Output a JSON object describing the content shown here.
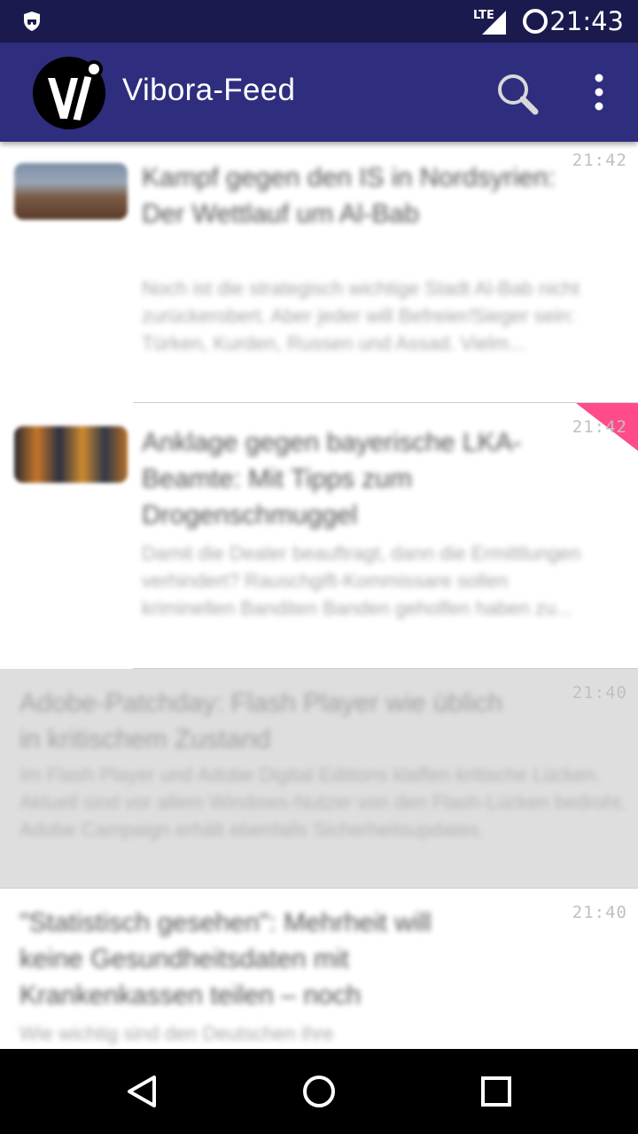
{
  "status_bar": {
    "network": "LTE",
    "time": "21:43",
    "icons": [
      "incognito-shield-icon",
      "signal-icon",
      "battery-saver-icon"
    ]
  },
  "app_bar": {
    "title": "Vibora-Feed",
    "logo": "vibora-logo",
    "actions": [
      "search-icon",
      "overflow-menu-icon"
    ],
    "color": "#2e2d7e"
  },
  "feed": {
    "items": [
      {
        "time": "21:42",
        "title": "Kampf gegen den IS in Nordsyrien: Der Wettlauf um Al-Bab",
        "description": "Noch ist die strategisch wichtige Stadt Al-Bab nicht zurückerobert. Aber jeder will Befreier/Sieger sein: Türken, Kurden, Russen und Assad. Vielm...",
        "has_thumbnail": true,
        "read": false,
        "new": false
      },
      {
        "time": "21:42",
        "title": "Anklage gegen bayerische LKA-Beamte: Mit Tipps zum Drogenschmuggel",
        "description": "Damit die Dealer beauftragt, dann die Ermittlungen verhindert? Rauschgift-Kommissare sollen kriminellen Banditen Banden geholfen haben zu...",
        "has_thumbnail": true,
        "read": false,
        "new": true
      },
      {
        "time": "21:40",
        "title": "Adobe-Patchday: Flash Player wie üblich in kritischem Zustand",
        "description": "Im Flash Player und Adobe Digital Editions klaffen kritische Lücken. Aktuell sind vor allem Windows-Nutzer von den Flash-Lücken bedroht. Adobe Campaign erhält ebenfalls Sicherheitsupdates.",
        "has_thumbnail": false,
        "read": true,
        "new": false
      },
      {
        "time": "21:40",
        "title": "\"Statistisch gesehen\": Mehrheit will keine Gesundheitsdaten mit Krankenkassen teilen – noch",
        "description": "Wie wichtig sind den Deutschen ihre",
        "has_thumbnail": false,
        "read": false,
        "new": false
      }
    ],
    "accent": "#ff4b8b"
  },
  "nav_bar": {
    "buttons": [
      "back-icon",
      "home-icon",
      "recents-icon"
    ]
  }
}
